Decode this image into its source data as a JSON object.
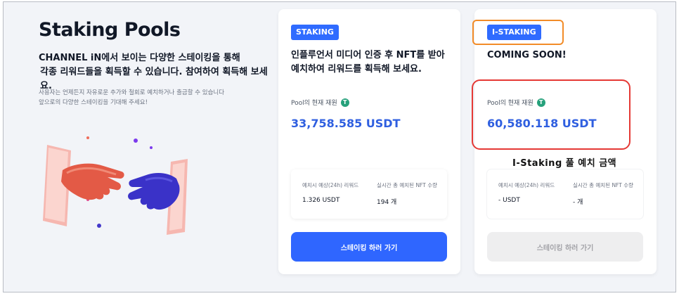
{
  "intro": {
    "title": "Staking Pools",
    "desc_line1": "CHANNEL iN에서 보이는 다양한 스테이킹을 통해",
    "desc_line2": "각종 리워드들을 획득할 수 있습니다. 참여하여 획득해 보세요.",
    "sub_line1": "사용자는 언제든지 자유로운 추가와 철회로 예치하거나 출금할 수 있습니다",
    "sub_line2": "앞으로의 다양한 스테이킹을 기대해 주세요!"
  },
  "cards": [
    {
      "badge": "STAKING",
      "head_line1": "인플루언서 미디어 인증 후 NFT를 받아",
      "head_line2": "예치하여 리워드를 획득해 보세요.",
      "pool_label": "Pool의 현재 재원",
      "pool_value": "33,758.585 USDT",
      "stat1_label": "예치시 예상(24h) 리워드",
      "stat1_value": "1.326 USDT",
      "stat2_label": "실시간 총 예치된 NFT 수량",
      "stat2_value": "194 개",
      "button": "스테이킹 하러 가기",
      "enabled": true
    },
    {
      "badge": "I-STAKING",
      "head_line1": "COMING SOON!",
      "head_line2": "",
      "pool_label": "Pool의 현재 재원",
      "pool_value": "60,580.118 USDT",
      "stat1_label": "예치시 예상(24h) 리워드",
      "stat1_value": "- USDT",
      "stat2_label": "실시간 총 예치된 NFT 수량",
      "stat2_value": "- 개",
      "button": "스테이킹 하러 가기",
      "enabled": false
    }
  ],
  "icons": {
    "token": "tether-icon",
    "token_glyph": "T"
  },
  "annotation": {
    "text": "I-Staking 풀 예치 금액"
  },
  "colors": {
    "accent": "#2f66ff",
    "value": "#2f5fe0",
    "highlight_orange": "#f28c28",
    "highlight_red": "#e53935",
    "tether": "#26a17b"
  }
}
